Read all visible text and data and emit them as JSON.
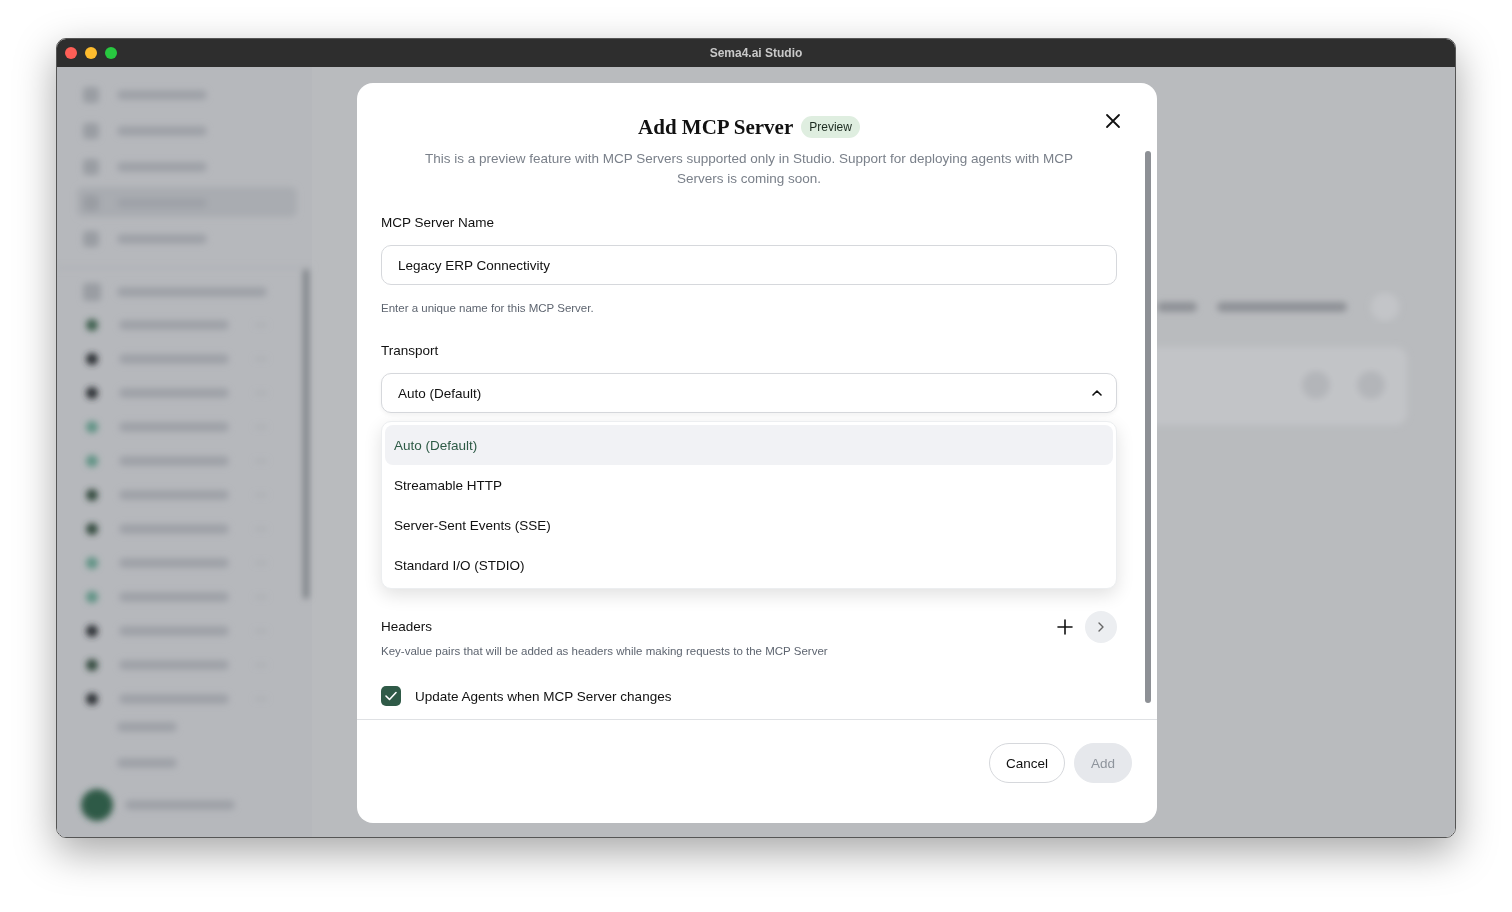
{
  "window": {
    "title": "Sema4.ai Studio"
  },
  "dialog": {
    "title": "Add MCP Server",
    "badge": "Preview",
    "description": "This is a preview feature with MCP Servers supported only in Studio. Support for deploying agents with MCP Servers is coming soon.",
    "name_field": {
      "label": "MCP Server Name",
      "value": "Legacy ERP Connectivity",
      "hint": "Enter a unique name for this MCP Server."
    },
    "transport": {
      "label": "Transport",
      "value": "Auto (Default)",
      "expanded": true,
      "options": [
        {
          "label": "Auto (Default)",
          "selected": true
        },
        {
          "label": "Streamable HTTP",
          "selected": false
        },
        {
          "label": "Server-Sent Events (SSE)",
          "selected": false
        },
        {
          "label": "Standard I/O (STDIO)",
          "selected": false
        }
      ]
    },
    "headers": {
      "label": "Headers",
      "hint": "Key-value pairs that will be added as headers while making requests to the MCP Server"
    },
    "update_agents": {
      "label": "Update Agents when MCP Server changes",
      "checked": true
    },
    "buttons": [
      {
        "label": "Cancel",
        "disabled": false
      },
      {
        "label": "Add",
        "disabled": true
      }
    ]
  }
}
